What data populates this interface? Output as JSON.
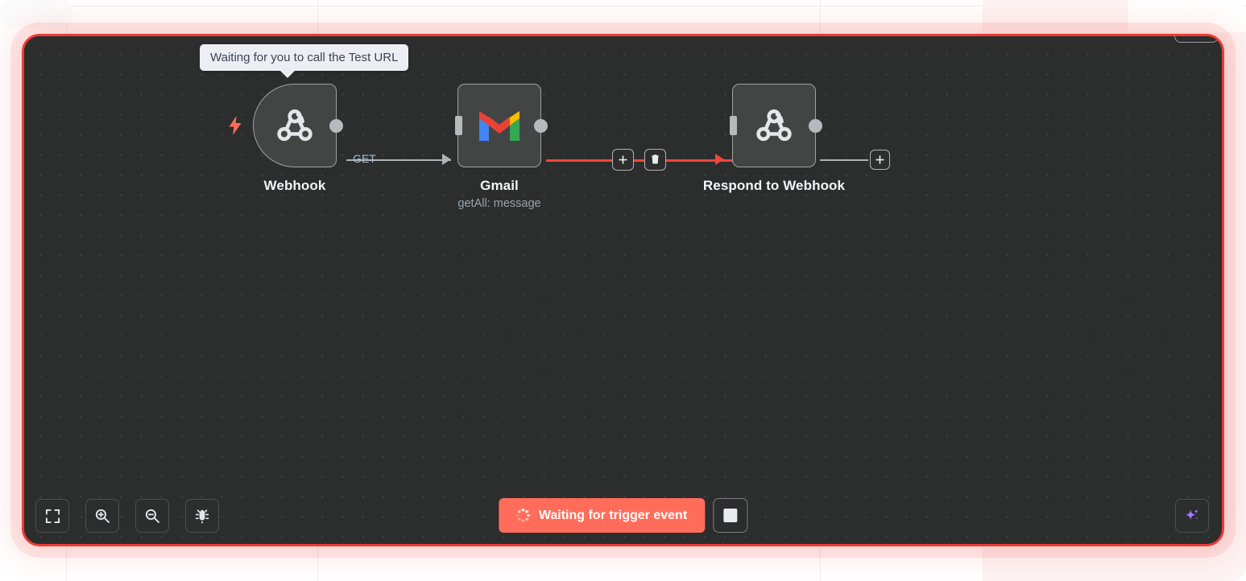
{
  "app": {
    "canvas_state": "waiting-for-trigger",
    "accent_color": "#ff6d5a",
    "error_border_color": "#ef3b35",
    "canvas_bg": "#2c2d2d"
  },
  "tooltip": {
    "text": "Waiting for you to call the Test URL"
  },
  "nodes": [
    {
      "id": "webhook",
      "label": "Webhook",
      "sublabel": "",
      "icon": "webhook-icon",
      "type": "trigger"
    },
    {
      "id": "gmail",
      "label": "Gmail",
      "sublabel": "getAll: message",
      "icon": "gmail-icon",
      "type": "action"
    },
    {
      "id": "respond-to-webhook",
      "label": "Respond to Webhook",
      "sublabel": "",
      "icon": "webhook-icon",
      "type": "action"
    }
  ],
  "connections": [
    {
      "id": "webhook-to-gmail",
      "label": "GET",
      "state": "idle"
    },
    {
      "id": "gmail-to-respond",
      "label": "",
      "state": "hovered"
    }
  ],
  "connection_actions": {
    "add_label": "+",
    "delete_label": "delete-icon"
  },
  "endpoint_add": {
    "label": "+"
  },
  "canvas_toolbar": [
    {
      "id": "zoom-to-fit",
      "icon": "fit-screen-icon",
      "tooltip": "Zoom to fit"
    },
    {
      "id": "zoom-in",
      "icon": "zoom-in-icon",
      "tooltip": "Zoom in"
    },
    {
      "id": "zoom-out",
      "icon": "zoom-out-icon",
      "tooltip": "Zoom out"
    },
    {
      "id": "debug",
      "icon": "bug-icon",
      "tooltip": "Debug"
    }
  ],
  "run_toolbar": {
    "waiting_label": "Waiting for trigger event",
    "waiting_icon": "spinner-icon",
    "stop_icon": "stop-square-icon"
  },
  "ai_assistant": {
    "icon": "sparkle-icon"
  }
}
